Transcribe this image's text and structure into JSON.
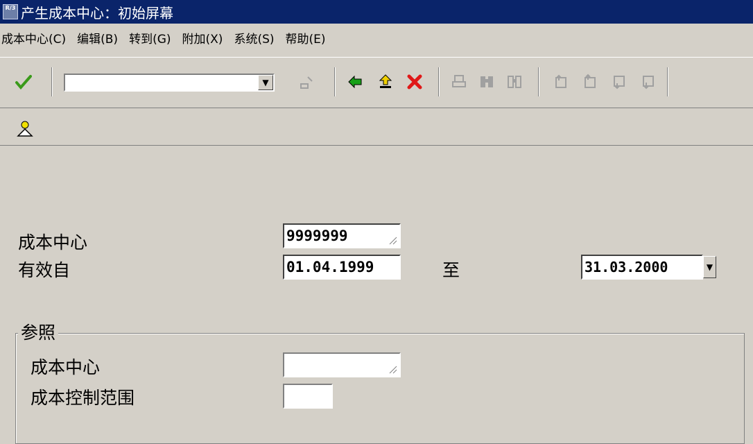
{
  "window": {
    "app_icon_text": "R/3",
    "title": "产生成本中心：初始屏幕"
  },
  "menu": [
    "成本中心(C)",
    "编辑(B)",
    "转到(G)",
    "附加(X)",
    "系统(S)",
    "帮助(E)"
  ],
  "toolbar": {
    "command_field_value": "",
    "icons": [
      "enter-check-icon",
      "save-icon",
      "back-icon",
      "exit-icon",
      "cancel-icon",
      "print-icon",
      "find-icon",
      "find-next-icon",
      "first-page-icon",
      "previous-page-icon",
      "next-page-icon",
      "last-page-icon"
    ]
  },
  "app_toolbar": {
    "icons": [
      "person-icon"
    ]
  },
  "form": {
    "cost_center_label": "成本中心",
    "cost_center_value": "9999999",
    "valid_from_label": "有效自",
    "valid_from_value": "01.04.1999",
    "to_label": "至",
    "valid_to_value": "31.03.2000"
  },
  "reference": {
    "title": "参照",
    "cost_center_label": "成本中心",
    "cost_center_value": "",
    "controlling_area_label": "成本控制范围",
    "controlling_area_value": ""
  },
  "colors": {
    "titlebar": "#0a246a",
    "window_bg": "#d4d0c8",
    "enter_green": "#3a9a1a",
    "back_green": "#18a018",
    "cancel_red": "#e01818",
    "disabled_gray": "#a0a0a0"
  }
}
